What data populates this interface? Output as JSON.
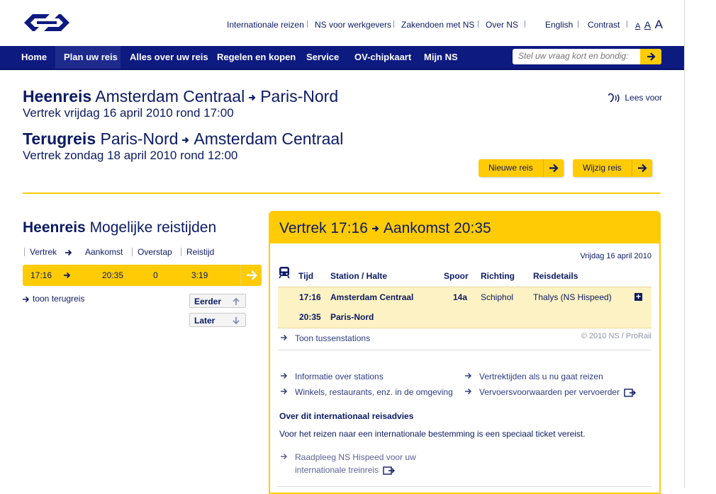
{
  "utility_nav": {
    "international": "Internationale reizen",
    "employers": "NS voor werkgevers",
    "business": "Zakendoen met NS",
    "about": "Over NS",
    "english": "English",
    "contrast": "Contrast",
    "font_small": "A",
    "font_medium": "A",
    "font_large": "A"
  },
  "nav": {
    "items": [
      {
        "label": "Home"
      },
      {
        "label": "Plan uw reis"
      },
      {
        "label": "Alles over uw reis"
      },
      {
        "label": "Regelen en kopen"
      },
      {
        "label": "Service"
      },
      {
        "label": "OV-chipkaart"
      },
      {
        "label": "Mijn NS"
      }
    ],
    "search_placeholder": "Stel uw vraag kort en bondig:"
  },
  "trip": {
    "outbound_label": "Heenreis",
    "outbound_from": "Amsterdam Centraal",
    "outbound_to": "Paris-Nord",
    "outbound_departure": "Vertrek vrijdag 16 april 2010 rond 17:00",
    "return_label": "Terugreis",
    "return_from": "Paris-Nord",
    "return_to": "Amsterdam Centraal",
    "return_departure": "Vertrek zondag 18 april 2010 rond 12:00",
    "read_aloud": "Lees voor",
    "new_trip": "Nieuwe reis",
    "change_trip": "Wijzig reis"
  },
  "options": {
    "title_bold": "Heenreis",
    "title_rest": "Mogelijke reistijden",
    "col_departure": "Vertrek",
    "col_arrival": "Aankomst",
    "col_transfer": "Overstap",
    "col_duration": "Reistijd",
    "row": {
      "departure": "17:16",
      "arrival": "20:35",
      "transfers": "0",
      "duration": "3:19"
    },
    "show_return": "toon terugreis",
    "earlier": "Eerder",
    "later": "Later"
  },
  "detail": {
    "title_departure": "Vertrek 17:16",
    "title_arrival": "Aankomst 20:35",
    "date": "Vrijdag 16 april 2010",
    "headers": {
      "time": "Tijd",
      "station": "Station / Halte",
      "platform": "Spoor",
      "direction": "Richting",
      "details": "Reisdetails"
    },
    "rows": [
      {
        "time": "17:16",
        "station": "Amsterdam Centraal",
        "platform": "14a",
        "direction": "Schiphol",
        "details": "Thalys (NS Hispeed)"
      },
      {
        "time": "20:35",
        "station": "Paris-Nord",
        "platform": "",
        "direction": "",
        "details": ""
      }
    ],
    "show_stations": "Toon tussenstations",
    "copyright": "© 2010 NS / ProRail",
    "links": {
      "station_info": "Informatie over stations",
      "shops": "Winkels, restaurants, enz. in de omgeving",
      "departures": "Vertrektijden als u nu gaat reizen",
      "conditions": "Vervoersvoorwaarden per vervoerder"
    },
    "advice_title": "Over dit internationaal reisadvies",
    "advice_text": "Voor het reizen naar een internationale bestemming is een speciaal ticket vereist.",
    "hispeed_line1": "Raadpleeg NS Hispeed voor uw",
    "hispeed_line2": "internationale treinreis"
  }
}
